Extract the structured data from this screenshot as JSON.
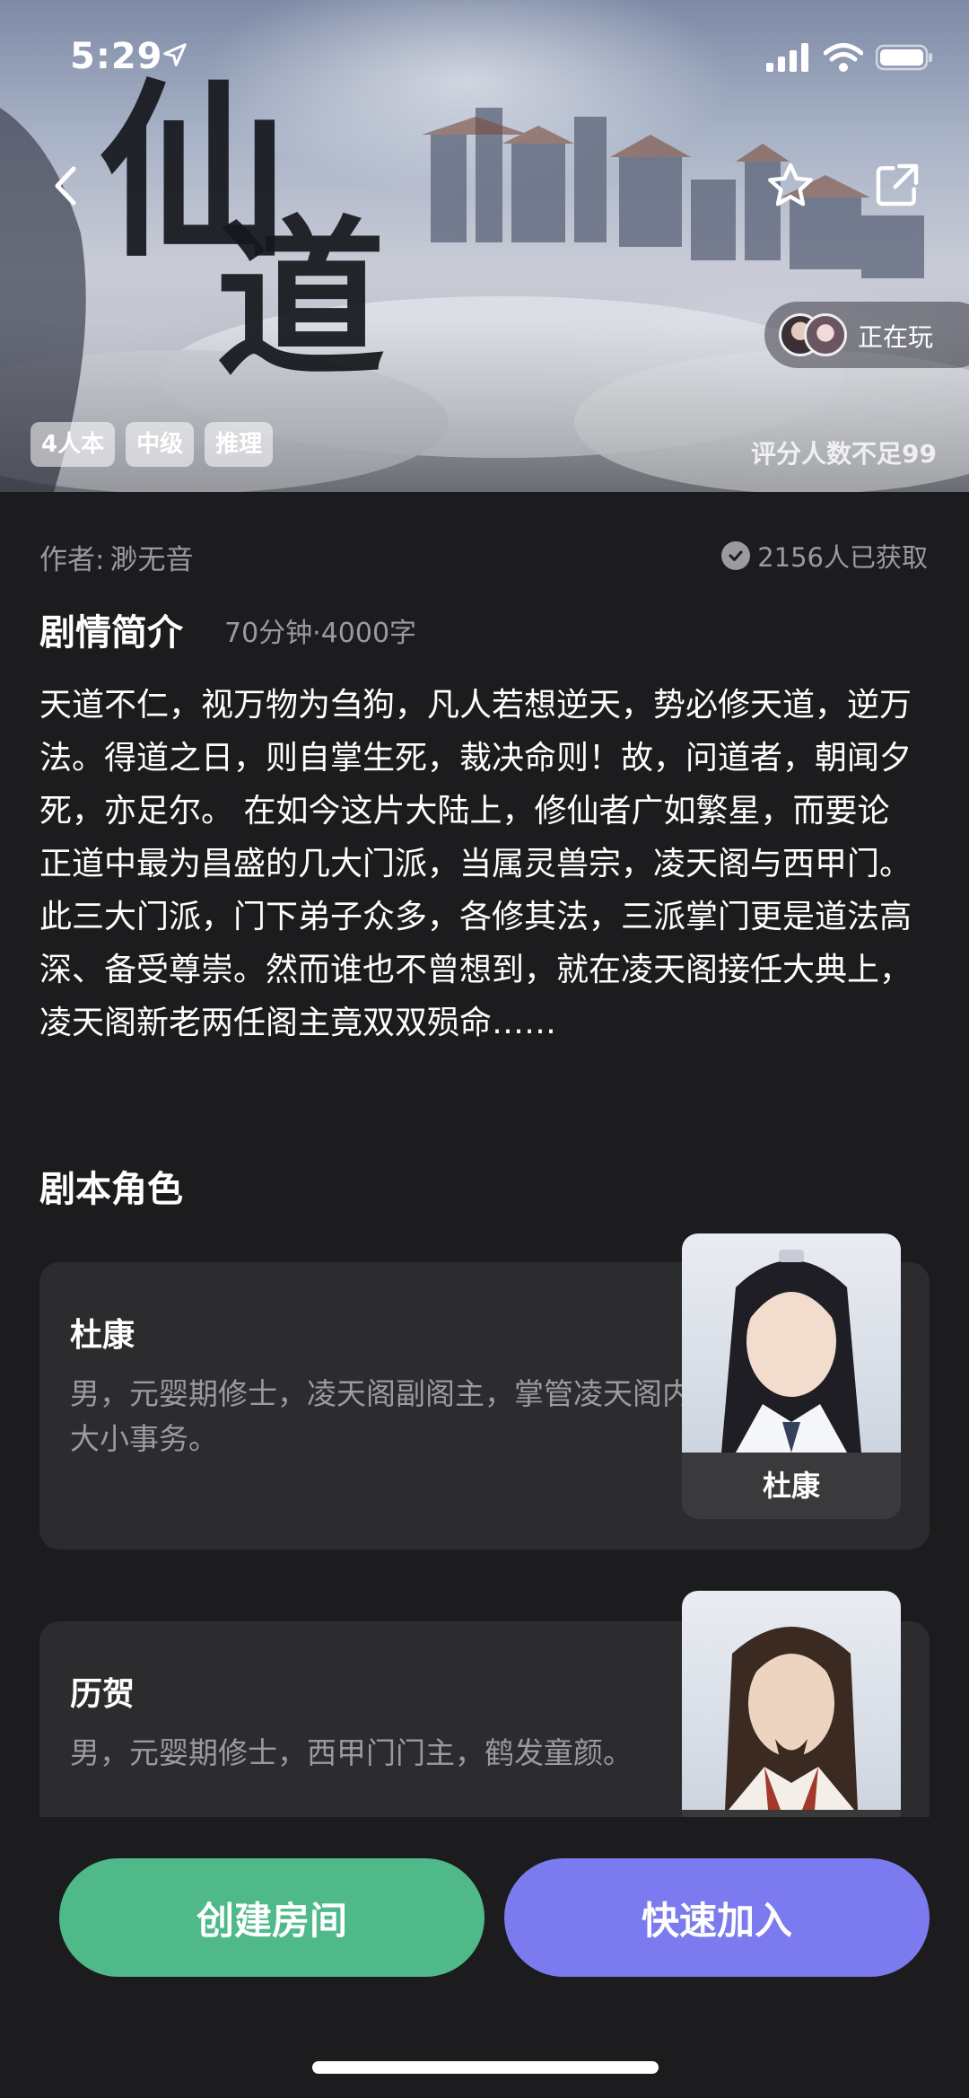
{
  "status_bar": {
    "time": "5:29"
  },
  "hero": {
    "playing_label": "正在玩",
    "tags": [
      "4人本",
      "中级",
      "推理"
    ],
    "rating_note": "评分人数不足99"
  },
  "info": {
    "author_label": "作者:",
    "author_name": "渺无音",
    "obtained": "2156人已获取"
  },
  "synopsis": {
    "title": "剧情简介",
    "meta": "70分钟·4000字",
    "text": "天道不仁，视万物为刍狗，凡人若想逆天，势必修天道，逆万法。得道之日，则自掌生死，裁决命则！故，问道者，朝闻夕死，亦足尔。 在如今这片大陆上，修仙者广如繁星，而要论正道中最为昌盛的几大门派，当属灵兽宗，凌天阁与西甲门。此三大门派，门下弟子众多，各修其法，三派掌门更是道法高深、备受尊崇。然而谁也不曾想到，就在凌天阁接任大典上，凌天阁新老两任阁主竟双双殒命……"
  },
  "roles": {
    "title": "剧本角色",
    "items": [
      {
        "name": "杜康",
        "desc": "男，元婴期修士，凌天阁副阁主，掌管凌天阁内大小事务。",
        "portrait_label": "杜康"
      },
      {
        "name": "历贺",
        "desc": "男，元婴期修士，西甲门门主，鹤发童颜。",
        "portrait_label": ""
      }
    ]
  },
  "actions": {
    "create": "创建房间",
    "join": "快速加入"
  }
}
